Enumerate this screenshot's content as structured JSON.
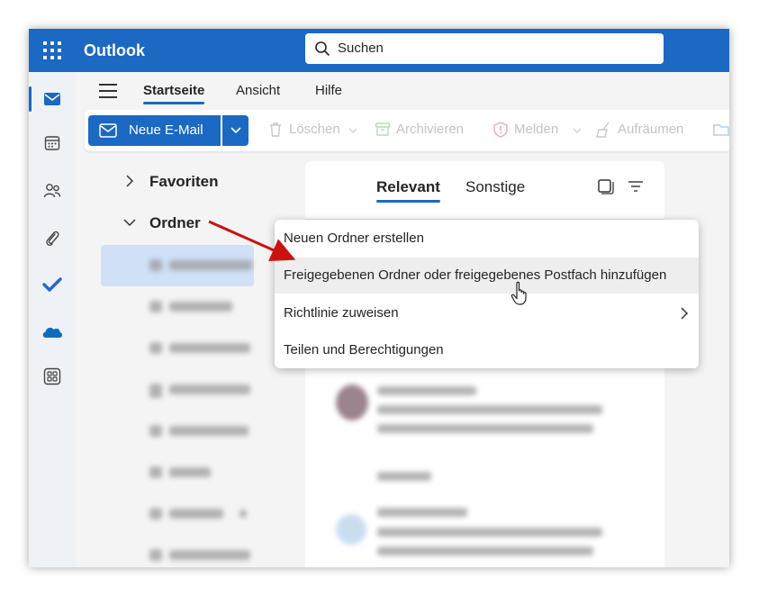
{
  "app": {
    "name": "Outlook",
    "accent": "#1b69c3"
  },
  "search": {
    "placeholder": "Suchen"
  },
  "rail": {
    "items": [
      "mail-icon",
      "calendar-icon",
      "people-icon",
      "attachment-icon",
      "todo-icon",
      "onedrive-icon",
      "apps-icon"
    ]
  },
  "ribbon": {
    "tabs": [
      "Startseite",
      "Ansicht",
      "Hilfe"
    ],
    "active_tab": "Startseite"
  },
  "toolbar": {
    "new_mail": "Neue E-Mail",
    "delete": "Löschen",
    "archive": "Archivieren",
    "report": "Melden",
    "sweep": "Aufräumen"
  },
  "folders": {
    "favorites": "Favoriten",
    "folders": "Ordner"
  },
  "message_list": {
    "tabs": [
      "Relevant",
      "Sonstige"
    ],
    "active_tab": "Relevant"
  },
  "context_menu": {
    "items": [
      "Neuen Ordner erstellen",
      "Freigegebenen Ordner oder freigegebenes Postfach hinzufügen",
      "Richtlinie zuweisen",
      "Teilen und Berechtigungen"
    ],
    "hovered_index": 1
  }
}
